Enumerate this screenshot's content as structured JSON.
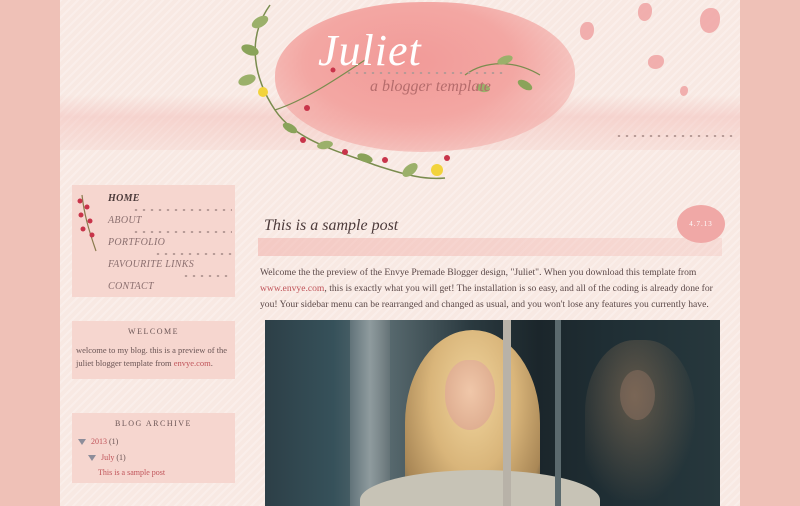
{
  "blog": {
    "title": "Juliet",
    "description": "a blogger template"
  },
  "nav": {
    "items": [
      {
        "label": "Home",
        "active": true
      },
      {
        "label": "About",
        "active": false
      },
      {
        "label": "Portfolio",
        "active": false
      },
      {
        "label": "Favourite Links",
        "active": false
      },
      {
        "label": "Contact",
        "active": false
      }
    ]
  },
  "welcome_widget": {
    "heading": "WELCOME",
    "text_before": "welcome to my blog. this is a preview of the juliet blogger template from ",
    "link": "envye.com",
    "text_after": "."
  },
  "archive_widget": {
    "heading": "BLOG ARCHIVE",
    "year": "2013",
    "year_count": "(1)",
    "month": "July",
    "month_count": "(1)",
    "post": "This is a sample post"
  },
  "post": {
    "title": "This is a sample post",
    "date": "4.7.13",
    "body_1": "Welcome the the preview of the Envye Premade Blogger design, \"Juliet\". When you download this template from ",
    "body_link": "www.envye.com",
    "body_2": ", this is exactly what you will get! The installation is so easy, and all of the coding is already done for you! Your sidebar menu can be rearranged and changed as usual, and you won't lose any features you currently have."
  },
  "colors": {
    "background": "#efc1b7",
    "page": "#f8e9e3",
    "accent_pink": "#f29a98",
    "link": "#c0545a",
    "text": "#5b4848"
  },
  "icons": [
    "flower-vine-icon",
    "berry-sprig-icon",
    "expand-triangle-icon"
  ]
}
